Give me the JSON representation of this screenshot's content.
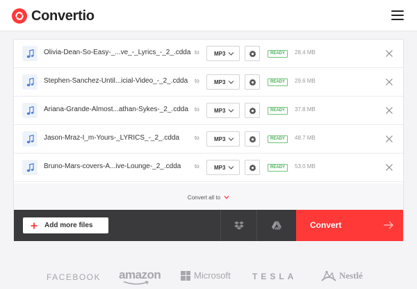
{
  "app": {
    "name": "Convertio",
    "brand_color": "#ff3838"
  },
  "header": {
    "logo_icon": "convertio-logo-icon",
    "menu_icon": "hamburger-menu-icon"
  },
  "files": [
    {
      "name": "Olivia-Dean-So-Easy-_...ve_-_Lyrics_-_2_.cdda",
      "to_label": "to",
      "format": "MP3",
      "status": "READY",
      "size": "28.4 MB"
    },
    {
      "name": "Stephen-Sanchez-Until...icial-Video_-_2_.cdda",
      "to_label": "to",
      "format": "MP3",
      "status": "READY",
      "size": "29.6 MB"
    },
    {
      "name": "Ariana-Grande-Almost...athan-Sykes-_2_.cdda",
      "to_label": "to",
      "format": "MP3",
      "status": "READY",
      "size": "37.8 MB"
    },
    {
      "name": "Jason-Mraz-I_m-Yours-_LYRICS_-_2_.cdda",
      "to_label": "to",
      "format": "MP3",
      "status": "READY",
      "size": "48.7 MB"
    },
    {
      "name": "Bruno-Mars-covers-A...ive-Lounge-_2_.cdda",
      "to_label": "to",
      "format": "MP3",
      "status": "READY",
      "size": "53.0 MB"
    }
  ],
  "convert_all": {
    "label": "Convert all to"
  },
  "actions": {
    "add_files_label": "Add more files",
    "convert_label": "Convert"
  },
  "brands": {
    "facebook": "FACEBOOK",
    "amazon": "amazon",
    "microsoft": "Microsoft",
    "tesla": "TESLA",
    "nestle": "Nestlé"
  }
}
